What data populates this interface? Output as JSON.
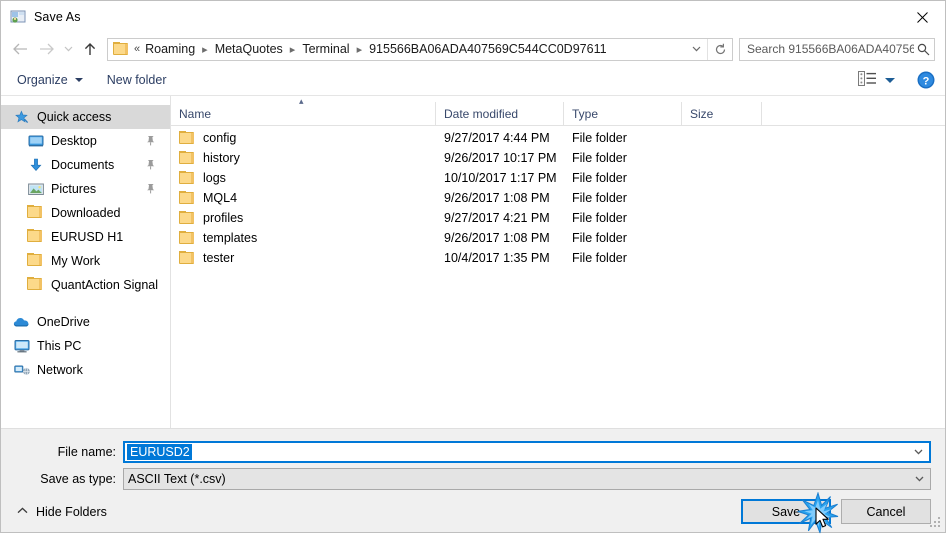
{
  "window": {
    "title": "Save As",
    "icon": "save-as-icon",
    "close_label": "✕"
  },
  "nav": {
    "back_icon": "back-arrow-icon",
    "forward_icon": "forward-arrow-icon",
    "recent_icon": "recent-locations-chevron-icon",
    "up_icon": "up-arrow-icon",
    "address": {
      "folder_icon": "folder-icon",
      "leading": "«",
      "crumbs": [
        "Roaming",
        "MetaQuotes",
        "Terminal",
        "915566BA06ADA407569C544CC0D97611"
      ],
      "dropdown_icon": "chevron-down-icon",
      "refresh_icon": "refresh-icon"
    },
    "search": {
      "placeholder": "Search 915566BA06ADA40756...",
      "icon": "search-icon"
    }
  },
  "toolbar": {
    "organize_label": "Organize",
    "new_folder_label": "New folder",
    "view_icon": "view-layout-icon",
    "view_caret_icon": "chevron-down-icon",
    "help_icon": "help-icon",
    "help_label": "?"
  },
  "sidebar": {
    "groups": [
      {
        "header": {
          "label": "Quick access",
          "icon": "star-pin-icon",
          "selected": true
        },
        "items": [
          {
            "label": "Desktop",
            "icon": "desktop-icon",
            "pinned": true
          },
          {
            "label": "Documents",
            "icon": "documents-download-icon",
            "pinned": true
          },
          {
            "label": "Pictures",
            "icon": "pictures-icon",
            "pinned": true
          },
          {
            "label": "Downloaded",
            "icon": "folder-icon",
            "pinned": false
          },
          {
            "label": "EURUSD H1",
            "icon": "folder-icon",
            "pinned": false
          },
          {
            "label": "My Work",
            "icon": "folder-icon",
            "pinned": false
          },
          {
            "label": "QuantAction Signal",
            "icon": "folder-icon",
            "pinned": false
          }
        ]
      },
      {
        "header": {
          "label": "OneDrive",
          "icon": "onedrive-cloud-icon",
          "selected": false
        },
        "items": []
      },
      {
        "header": {
          "label": "This PC",
          "icon": "this-pc-icon",
          "selected": false
        },
        "items": []
      },
      {
        "header": {
          "label": "Network",
          "icon": "network-icon",
          "selected": false
        },
        "items": []
      }
    ]
  },
  "filelist": {
    "columns": [
      "Name",
      "Date modified",
      "Type",
      "Size"
    ],
    "sort": {
      "column": "Name",
      "direction": "ascending",
      "indicator": "▴"
    },
    "rows": [
      {
        "name": "config",
        "date": "9/27/2017 4:44 PM",
        "type": "File folder",
        "size": ""
      },
      {
        "name": "history",
        "date": "9/26/2017 10:17 PM",
        "type": "File folder",
        "size": ""
      },
      {
        "name": "logs",
        "date": "10/10/2017 1:17 PM",
        "type": "File folder",
        "size": ""
      },
      {
        "name": "MQL4",
        "date": "9/26/2017 1:08 PM",
        "type": "File folder",
        "size": ""
      },
      {
        "name": "profiles",
        "date": "9/27/2017 4:21 PM",
        "type": "File folder",
        "size": ""
      },
      {
        "name": "templates",
        "date": "9/26/2017 1:08 PM",
        "type": "File folder",
        "size": ""
      },
      {
        "name": "tester",
        "date": "10/4/2017 1:35 PM",
        "type": "File folder",
        "size": ""
      }
    ]
  },
  "form": {
    "file_name_label": "File name:",
    "file_name_value": "EURUSD2",
    "save_as_type_label": "Save as type:",
    "save_as_type_value": "ASCII Text (*.csv)",
    "dropdown_icon": "chevron-down-icon"
  },
  "footer": {
    "hide_folders_label": "Hide Folders",
    "hide_folders_icon": "chevron-up-icon",
    "save_label": "Save",
    "cancel_label": "Cancel",
    "resize_grip_icon": "resize-grip-icon",
    "cursor_icon": "mouse-pointer-icon",
    "click_effect_icon": "click-burst-icon"
  },
  "colors": {
    "accent": "#0078d7",
    "selection": "#0078d7",
    "selected_row": "#d9d9d9",
    "column_header_text": "#38486b",
    "toolbar_text": "#2c3e63",
    "folder_yellow": "#fcd98a",
    "dialog_chrome": "#f0f0f0"
  }
}
